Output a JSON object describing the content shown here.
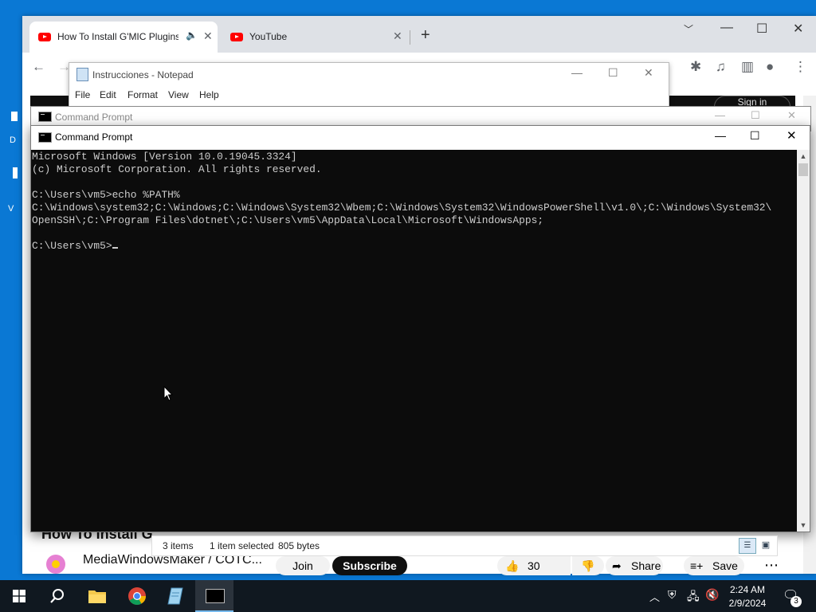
{
  "browser": {
    "tabs": [
      {
        "title": "How To Install G'MIC Plugins",
        "active": true
      },
      {
        "title": "YouTube",
        "active": false
      }
    ],
    "new_tab_symbol": "+"
  },
  "youtube": {
    "signin_label": "Sign in",
    "video_title_partial": "How To Install G",
    "channel_name": "MediaWindowsMaker / COTC...",
    "join_label": "Join",
    "subscribe_label": "Subscribe",
    "like_count": "30",
    "share_label": "Share",
    "save_label": "Save"
  },
  "notepad": {
    "title": "Instrucciones - Notepad",
    "menu": [
      "File",
      "Edit",
      "Format",
      "View",
      "Help"
    ]
  },
  "cmd_back": {
    "title": "Command Prompt"
  },
  "cmd": {
    "title": "Command Prompt",
    "lines": [
      "Microsoft Windows [Version 10.0.19045.3324]",
      "(c) Microsoft Corporation. All rights reserved.",
      "",
      "C:\\Users\\vm5>echo %PATH%",
      "C:\\Windows\\system32;C:\\Windows;C:\\Windows\\System32\\Wbem;C:\\Windows\\System32\\WindowsPowerShell\\v1.0\\;C:\\Windows\\System32\\",
      "OpenSSH\\;C:\\Program Files\\dotnet\\;C:\\Users\\vm5\\AppData\\Local\\Microsoft\\WindowsApps;",
      ""
    ],
    "prompt": "C:\\Users\\vm5>"
  },
  "explorer_status": {
    "items": "3 items",
    "selected": "1 item selected",
    "size": "805 bytes"
  },
  "taskbar": {
    "time": "2:24 AM",
    "date": "2/9/2024",
    "notification_count": "3"
  },
  "colors": {
    "desktop": "#0a78d4",
    "console_bg": "#0c0c0c",
    "console_fg": "#cccccc",
    "youtube_red": "#ff0000",
    "taskbar": "#101820"
  }
}
